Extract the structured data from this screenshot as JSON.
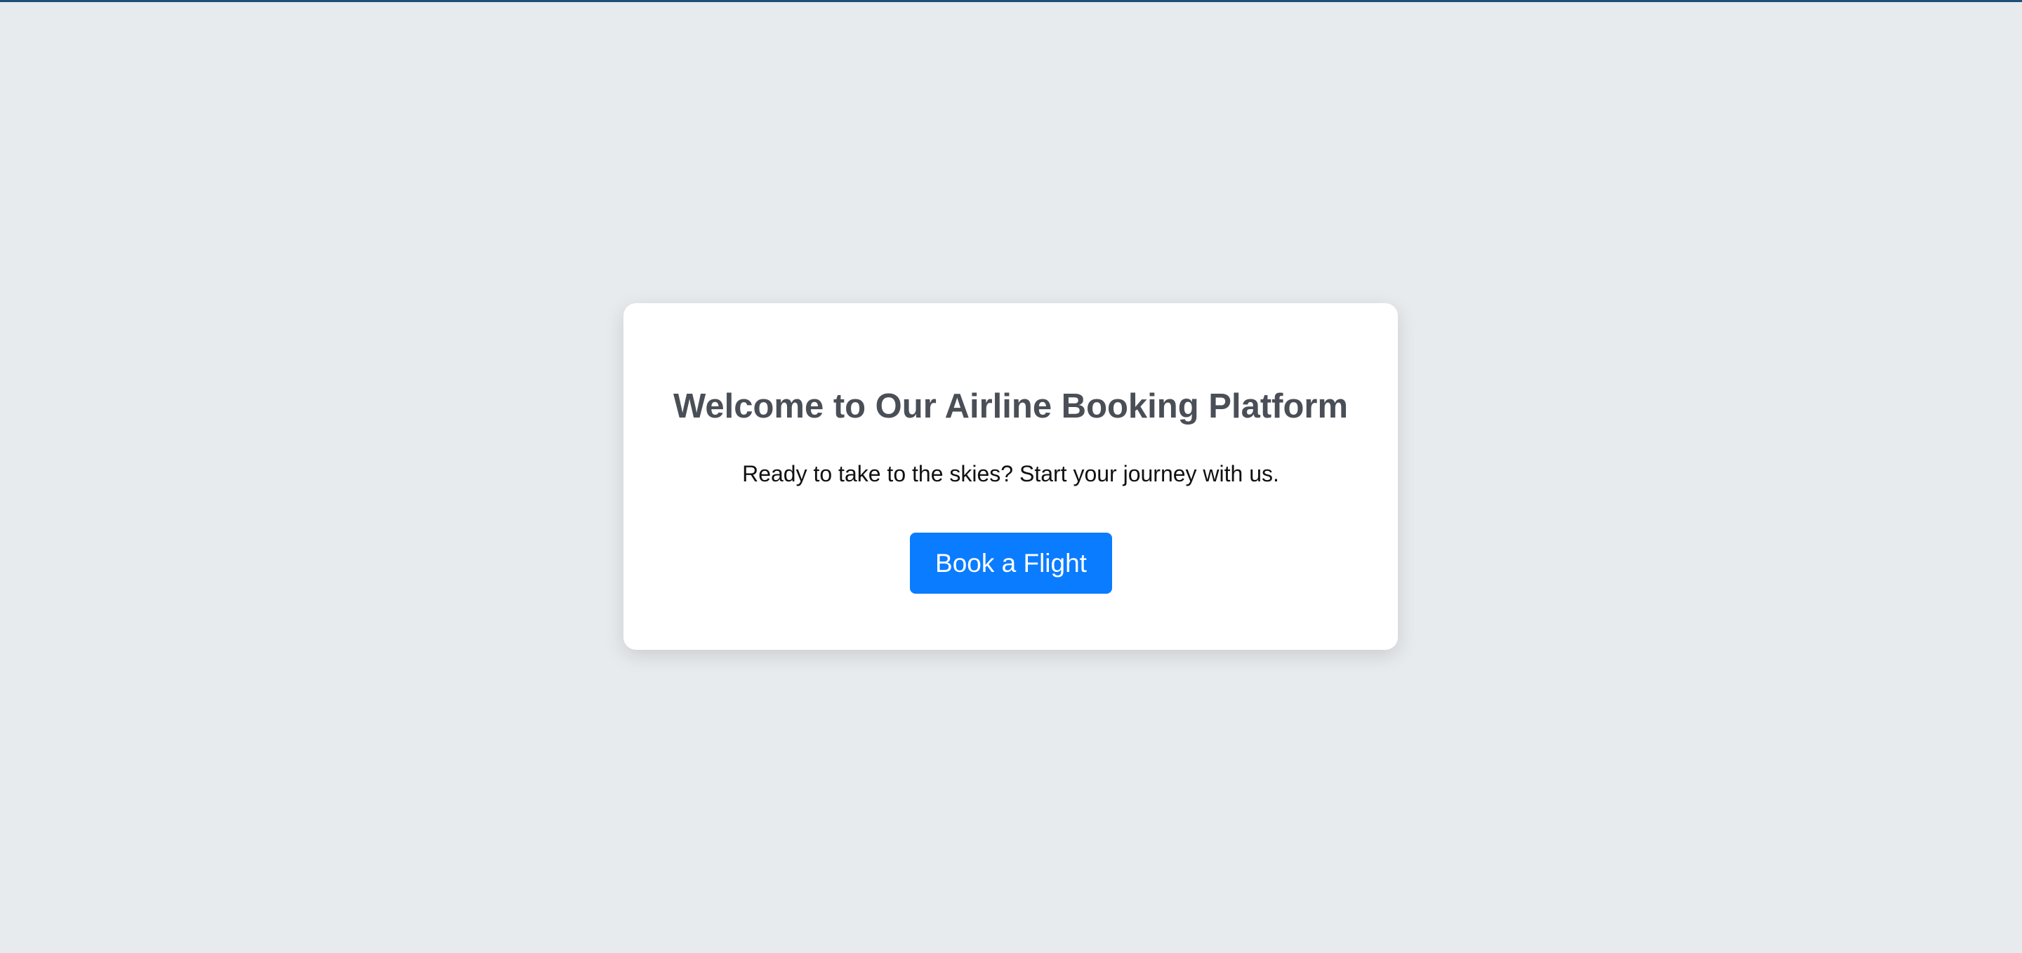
{
  "hero": {
    "title": "Welcome to Our Airline Booking Platform",
    "subtitle": "Ready to take to the skies? Start your journey with us.",
    "button_label": "Book a Flight"
  },
  "colors": {
    "page_background": "#e8ebee",
    "card_background": "#ffffff",
    "title_text": "#4a4f57",
    "body_text": "#111111",
    "button_background": "#0a7cff",
    "button_text": "#ffffff",
    "top_edge": "#1f4f78"
  }
}
